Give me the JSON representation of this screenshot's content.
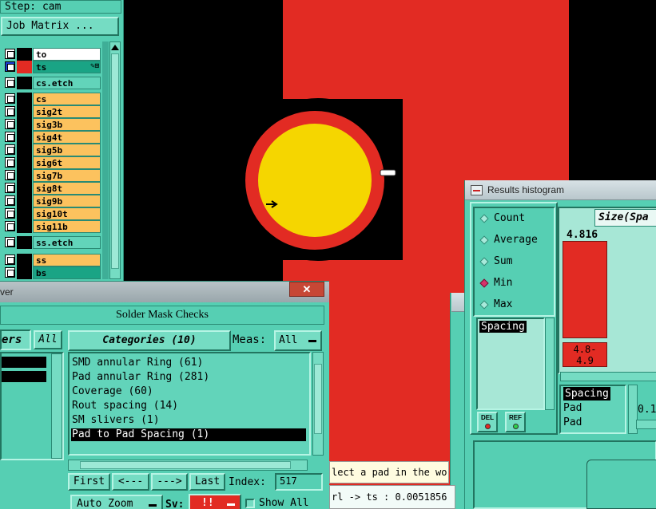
{
  "left_panel": {
    "step_label": "Step: cam",
    "job_matrix_button": "Job Matrix ...",
    "layers": [
      {
        "name": "to",
        "row_color": "#ffffff",
        "swatch": "#000000"
      },
      {
        "name": "ts",
        "row_color": "#1aa485",
        "swatch": "#e22b23",
        "flags": "✎⊞"
      },
      {
        "name": "cs.etch",
        "row_color": "#62d4ba",
        "swatch": "#000000"
      },
      {
        "name": "cs",
        "row_color": "#fcc25e",
        "swatch": "#000000"
      },
      {
        "name": "sig2t",
        "row_color": "#fcc25e",
        "swatch": "#000000"
      },
      {
        "name": "sig3b",
        "row_color": "#fcc25e",
        "swatch": "#000000"
      },
      {
        "name": "sig4t",
        "row_color": "#fcc25e",
        "swatch": "#000000"
      },
      {
        "name": "sig5b",
        "row_color": "#fcc25e",
        "swatch": "#000000"
      },
      {
        "name": "sig6t",
        "row_color": "#fcc25e",
        "swatch": "#000000"
      },
      {
        "name": "sig7b",
        "row_color": "#fcc25e",
        "swatch": "#000000"
      },
      {
        "name": "sig8t",
        "row_color": "#fcc25e",
        "swatch": "#000000"
      },
      {
        "name": "sig9b",
        "row_color": "#fcc25e",
        "swatch": "#000000"
      },
      {
        "name": "sig10t",
        "row_color": "#fcc25e",
        "swatch": "#000000"
      },
      {
        "name": "sig11b",
        "row_color": "#fcc25e",
        "swatch": "#000000"
      },
      {
        "name": "ss.etch",
        "row_color": "#62d4ba",
        "swatch": "#000000"
      },
      {
        "name": "ss",
        "row_color": "#fcc25e",
        "swatch": "#000000"
      },
      {
        "name": "bs",
        "row_color": "#1aa485",
        "swatch": "#000000"
      }
    ]
  },
  "solder_mask": {
    "window_title_fragment": "ver",
    "close_glyph": "✕",
    "heading": "Solder Mask Checks",
    "filters_label": "ers",
    "filters_all": "All",
    "categories_label": "Categories (10)",
    "meas_label": "Meas:",
    "meas_value": "All",
    "categories": [
      {
        "text": "SMD annular Ring (61)",
        "selected": false
      },
      {
        "text": "Pad annular Ring (281)",
        "selected": false
      },
      {
        "text": "Coverage (60)",
        "selected": false
      },
      {
        "text": "Rout spacing (14)",
        "selected": false
      },
      {
        "text": "SM slivers (1)",
        "selected": false
      },
      {
        "text": "Pad to Pad Spacing (1)",
        "selected": true
      }
    ],
    "nav": {
      "first": "First",
      "prev": "<---",
      "next": "--->",
      "last": "Last",
      "index_label": "Index:",
      "index_value": "517"
    },
    "auto_zoom": "Auto Zoom",
    "sv_label": "Sv:",
    "sv_value": "!!",
    "show_all": "Show All"
  },
  "histogram": {
    "title": "Results histogram",
    "modes": [
      {
        "label": "Count",
        "selected": false
      },
      {
        "label": "Average",
        "selected": false
      },
      {
        "label": "Sum",
        "selected": false
      },
      {
        "label": "Min",
        "selected": true
      },
      {
        "label": "Max",
        "selected": false
      }
    ],
    "size_label": "Size(Spa",
    "measurement": "Spacing",
    "results": [
      {
        "text": "Spacing",
        "selected": true
      },
      {
        "text": "Pad",
        "selected": false
      },
      {
        "text": "Pad",
        "selected": false
      }
    ],
    "value_fragment": "0.1",
    "del_button": "DEL",
    "ref_button": "REF"
  },
  "chart_data": {
    "type": "bar",
    "categories": [
      "4.8-\n4.9"
    ],
    "values": [
      4.816
    ],
    "value_label": "4.816"
  },
  "status": {
    "message": "lect a pad in the worl",
    "readout": "rl -> ts : 0.0051856"
  },
  "colors": {
    "panel_teal": "#56cfb3",
    "feature_red": "#e22b23",
    "pad_yellow": "#f5d600",
    "canvas_black": "#000000",
    "layer_orange": "#fcc25e"
  }
}
